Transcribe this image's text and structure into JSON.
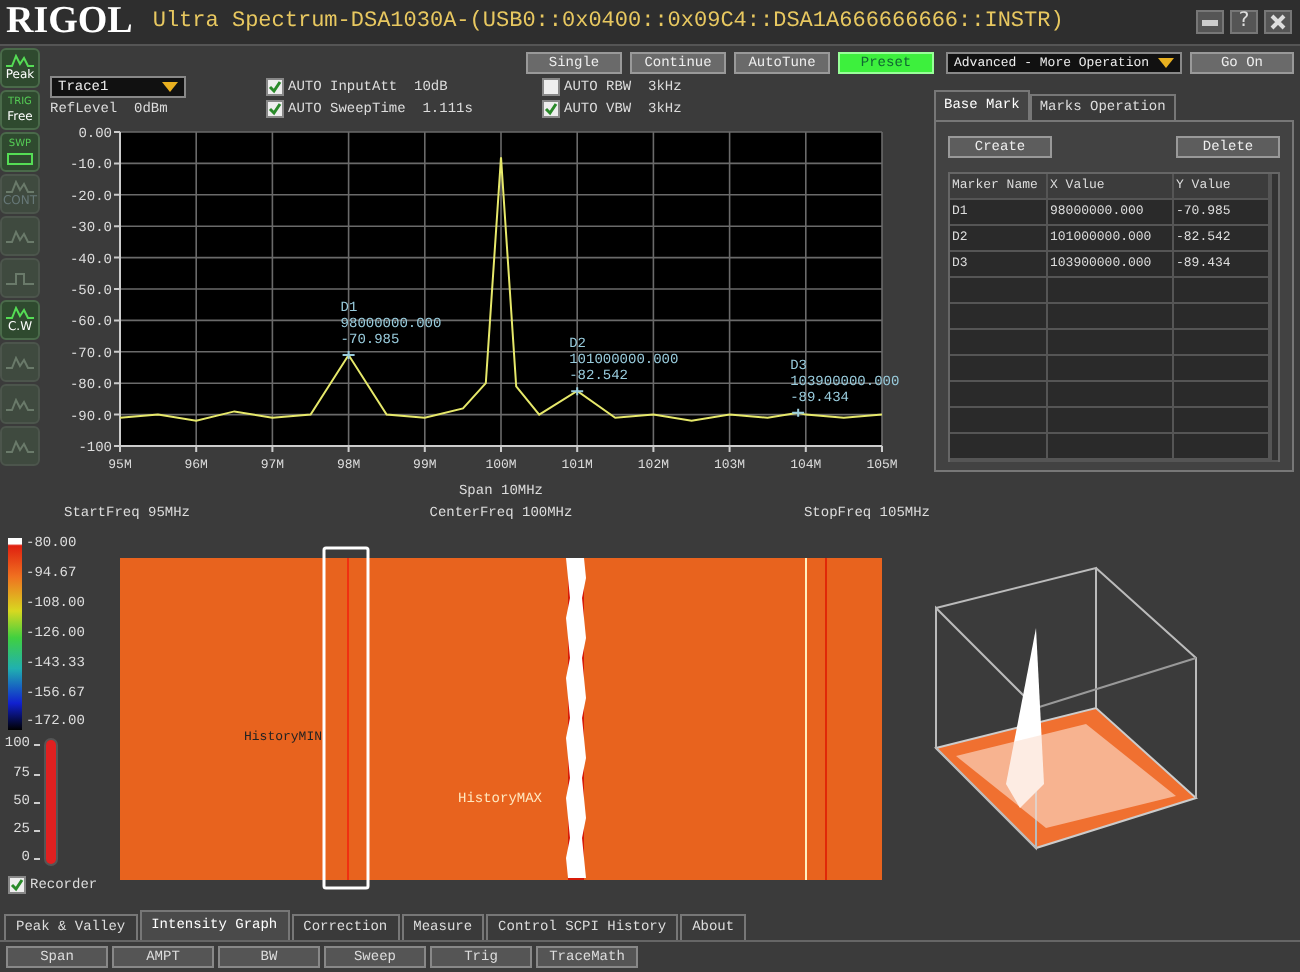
{
  "window": {
    "logo": "RIGOL",
    "title": "Ultra Spectrum-DSA1030A-(USB0::0x0400::0x09C4::DSA1A666666666::INSTR)",
    "help_glyph": "?"
  },
  "sidebar": {
    "items": [
      {
        "kind": "wave",
        "label": "Peak",
        "disabled": false
      },
      {
        "kind": "text",
        "caption": "TRIG",
        "label": "Free",
        "disabled": false
      },
      {
        "kind": "sweep",
        "caption": "SWP",
        "disabled": false
      },
      {
        "kind": "wave",
        "label": "CONT",
        "disabled": true
      },
      {
        "kind": "wave",
        "disabled": true
      },
      {
        "kind": "pulse",
        "disabled": true
      },
      {
        "kind": "wave",
        "label": "C.W",
        "disabled": false
      },
      {
        "kind": "wave",
        "disabled": true
      },
      {
        "kind": "wave",
        "disabled": true
      },
      {
        "kind": "wave",
        "disabled": true
      }
    ]
  },
  "run_buttons": [
    {
      "label": "Single",
      "selected": false
    },
    {
      "label": "Continue",
      "selected": false
    },
    {
      "label": "AutoTune",
      "selected": false
    },
    {
      "label": "Preset",
      "selected": true
    }
  ],
  "operation_select": {
    "value": "Advanced - More Operation"
  },
  "go_button": "Go On",
  "ref_level": {
    "label": "RefLevel",
    "value": "0dBm"
  },
  "auto_settings": [
    {
      "auto": "AUTO",
      "name": "InputAtt",
      "value": "10dB",
      "checked": true
    },
    {
      "auto": "AUTO",
      "name": "SweepTime",
      "value": "1.111s",
      "checked": true
    },
    {
      "auto": "AUTO",
      "name": "RBW",
      "value": "3kHz",
      "checked": false
    },
    {
      "auto": "AUTO",
      "name": "VBW",
      "value": "3kHz",
      "checked": true
    }
  ],
  "spectrum": {
    "chart_data": {
      "type": "line",
      "x": [
        95,
        95.5,
        96,
        96.5,
        97,
        97.5,
        98,
        98.5,
        99,
        99.5,
        99.8,
        100,
        100.2,
        100.5,
        101,
        101.5,
        102,
        102.5,
        103,
        103.5,
        103.9,
        104,
        104.5,
        105
      ],
      "series": [
        {
          "name": "Trace1",
          "color": "#e6e86a",
          "values": [
            -91,
            -90,
            -92,
            -89,
            -91,
            -90,
            -71,
            -90,
            -91,
            -88,
            -80,
            -8,
            -81,
            -90,
            -82.5,
            -91,
            -90,
            -92,
            -90,
            -91,
            -89.4,
            -90,
            -91,
            -90
          ]
        }
      ],
      "xlim": [
        95,
        105
      ],
      "ylim": [
        -100,
        0
      ],
      "grid": true,
      "xticks": [
        {
          "value": 95,
          "label": "95M"
        },
        {
          "value": 96,
          "label": "96M"
        },
        {
          "value": 97,
          "label": "97M"
        },
        {
          "value": 98,
          "label": "98M"
        },
        {
          "value": 99,
          "label": "99M"
        },
        {
          "value": 100,
          "label": "100M"
        },
        {
          "value": 101,
          "label": "101M"
        },
        {
          "value": 102,
          "label": "102M"
        },
        {
          "value": 103,
          "label": "103M"
        },
        {
          "value": 104,
          "label": "104M"
        },
        {
          "value": 105,
          "label": "105M"
        }
      ],
      "yticks": [
        {
          "value": 0,
          "label": "0.00"
        },
        {
          "value": -10,
          "label": "-10.0"
        },
        {
          "value": -20,
          "label": "-20.0"
        },
        {
          "value": -30,
          "label": "-30.0"
        },
        {
          "value": -40,
          "label": "-40.0"
        },
        {
          "value": -50,
          "label": "-50.0"
        },
        {
          "value": -60,
          "label": "-60.0"
        },
        {
          "value": -70,
          "label": "-70.0"
        },
        {
          "value": -80,
          "label": "-80.0"
        },
        {
          "value": -90,
          "label": "-90.0"
        },
        {
          "value": -100,
          "label": "-100"
        }
      ],
      "annotations": [
        {
          "x": 98,
          "y": -70.985,
          "text": "D1 98000000.000 -70.985"
        },
        {
          "x": 101,
          "y": -82.542,
          "text": "D2 101000000.000 -82.542"
        },
        {
          "x": 103.9,
          "y": -89.434,
          "text": "D3 103900000.000 -89.434"
        }
      ]
    },
    "span": {
      "label": "Span",
      "value": "10MHz"
    },
    "start": {
      "label": "StartFreq",
      "value": "95MHz"
    },
    "center": {
      "label": "CenterFreq",
      "value": "100MHz"
    },
    "stop": {
      "label": "StopFreq",
      "value": "105MHz"
    }
  },
  "marker_panel": {
    "tabs": [
      {
        "label": "Base Mark",
        "selected": true
      },
      {
        "label": "Marks Operation",
        "selected": false
      }
    ],
    "buttons": [
      "Create",
      "Delete"
    ],
    "columns": [
      "Marker Name",
      "X Value",
      "Y Value"
    ],
    "rows": [
      [
        "D1",
        "98000000.000",
        "-70.985"
      ],
      [
        "D2",
        "101000000.000",
        "-82.542"
      ],
      [
        "D3",
        "103900000.000",
        "-89.434"
      ]
    ]
  },
  "color_scale": [
    "-80.00",
    "-94.67",
    "-108.00",
    "-126.00",
    "-143.33",
    "-156.67",
    "-172.00"
  ],
  "history_meter": {
    "ticks": [
      "100",
      "75",
      "50",
      "25",
      "0"
    ],
    "level": 1
  },
  "recorder": {
    "label": "Recorder",
    "checked": true
  },
  "waterfall": {
    "labels": [
      "HistoryMIN",
      "HistoryMAX"
    ]
  },
  "bottom_tabs": [
    {
      "label": "Peak & Valley",
      "selected": false
    },
    {
      "label": "Intensity Graph",
      "selected": true
    },
    {
      "label": "Correction",
      "selected": false
    },
    {
      "label": "Measure",
      "selected": false
    },
    {
      "label": "Control SCPI History",
      "selected": false
    },
    {
      "label": "About",
      "selected": false
    }
  ],
  "bottom_buttons": [
    "Span",
    "AMPT",
    "BW",
    "Sweep",
    "Trig",
    "TraceMath"
  ]
}
